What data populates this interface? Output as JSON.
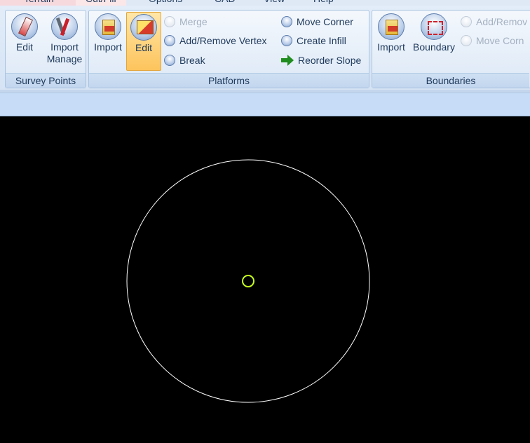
{
  "tabs": [
    "Terrain",
    "Cut/Fill",
    "Options",
    "CAD",
    "View",
    "Help"
  ],
  "groups": {
    "survey_points": {
      "label": "Survey Points",
      "buttons": [
        {
          "label": "Edit",
          "icon": "pen-icon"
        },
        {
          "label": "Import\nManage",
          "icon": "tools-icon"
        }
      ]
    },
    "platforms": {
      "label": "Platforms",
      "buttons": [
        {
          "label": "Import",
          "icon": "import-icon"
        },
        {
          "label": "Edit",
          "icon": "edit-icon",
          "active": true
        }
      ],
      "small_buttons": [
        {
          "label": "Merge",
          "enabled": false
        },
        {
          "label": "Add/Remove Vertex",
          "enabled": true
        },
        {
          "label": "Break",
          "enabled": true
        },
        {
          "label": "Move Corner",
          "enabled": true
        },
        {
          "label": "Create Infill",
          "enabled": true
        },
        {
          "label": "Reorder Slope",
          "enabled": true,
          "icon": "green-arrow-icon"
        }
      ]
    },
    "boundaries": {
      "label": "Boundaries",
      "buttons": [
        {
          "label": "Import",
          "icon": "import-icon"
        },
        {
          "label": "Boundary",
          "icon": "boundary-icon"
        }
      ],
      "small_buttons": [
        {
          "label": "Add/Remov",
          "enabled": false
        },
        {
          "label": "Move Corn",
          "enabled": false
        }
      ]
    }
  },
  "canvas": {
    "background": "#000000",
    "circle_color": "#ffffff",
    "marker_color": "#c6ff1e"
  }
}
